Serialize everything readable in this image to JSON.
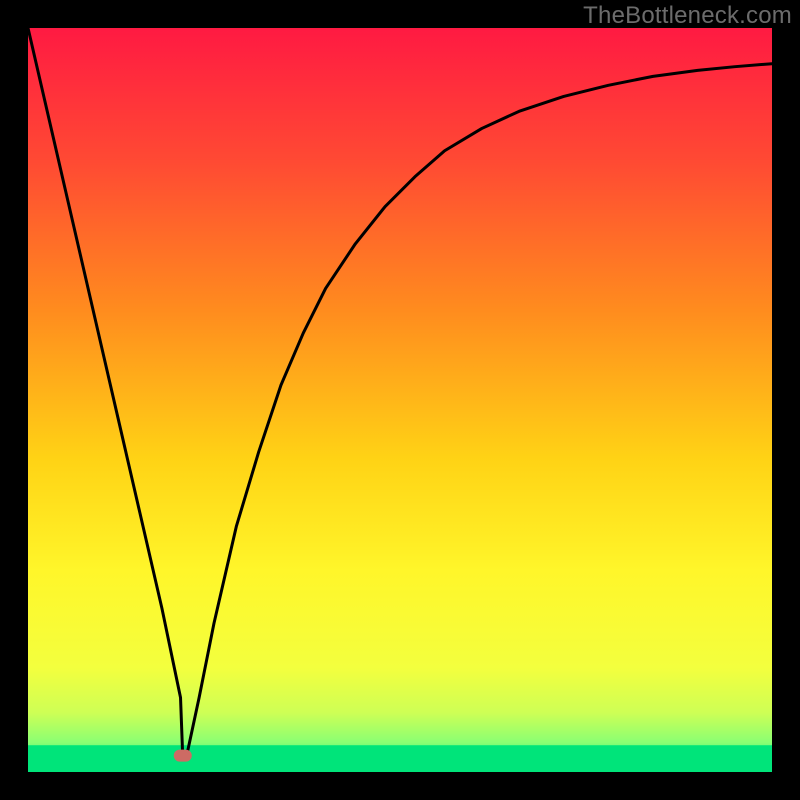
{
  "watermark": "TheBottleneck.com",
  "chart_data": {
    "type": "line",
    "title": "",
    "xlabel": "",
    "ylabel": "",
    "xlim": [
      0,
      100
    ],
    "ylim": [
      0,
      100
    ],
    "curve": {
      "name": "bottleneck-curve",
      "x": [
        0,
        3,
        6,
        9,
        12,
        15,
        18,
        20.5,
        20.8,
        21.5,
        23,
        25,
        28,
        31,
        34,
        37,
        40,
        44,
        48,
        52,
        56,
        61,
        66,
        72,
        78,
        84,
        90,
        95,
        100
      ],
      "y": [
        100,
        87,
        74,
        61,
        48,
        35,
        22,
        10,
        2,
        3,
        10,
        20,
        33,
        43,
        52,
        59,
        65,
        71,
        76,
        80,
        83.5,
        86.5,
        88.8,
        90.8,
        92.3,
        93.5,
        94.3,
        94.8,
        95.2
      ]
    },
    "marker": {
      "x": 20.8,
      "y": 2.2,
      "color": "#cd6b64"
    },
    "gradient_stops": [
      {
        "offset": 0.0,
        "color": "#ff1a42"
      },
      {
        "offset": 0.18,
        "color": "#ff4a33"
      },
      {
        "offset": 0.38,
        "color": "#ff8c1e"
      },
      {
        "offset": 0.58,
        "color": "#ffd315"
      },
      {
        "offset": 0.73,
        "color": "#fff62a"
      },
      {
        "offset": 0.86,
        "color": "#f3ff3e"
      },
      {
        "offset": 0.92,
        "color": "#ceff55"
      },
      {
        "offset": 0.96,
        "color": "#8bff73"
      },
      {
        "offset": 1.0,
        "color": "#00e47a"
      }
    ],
    "bottom_band": {
      "y_top": 3.6,
      "color": "#00e47a"
    }
  }
}
